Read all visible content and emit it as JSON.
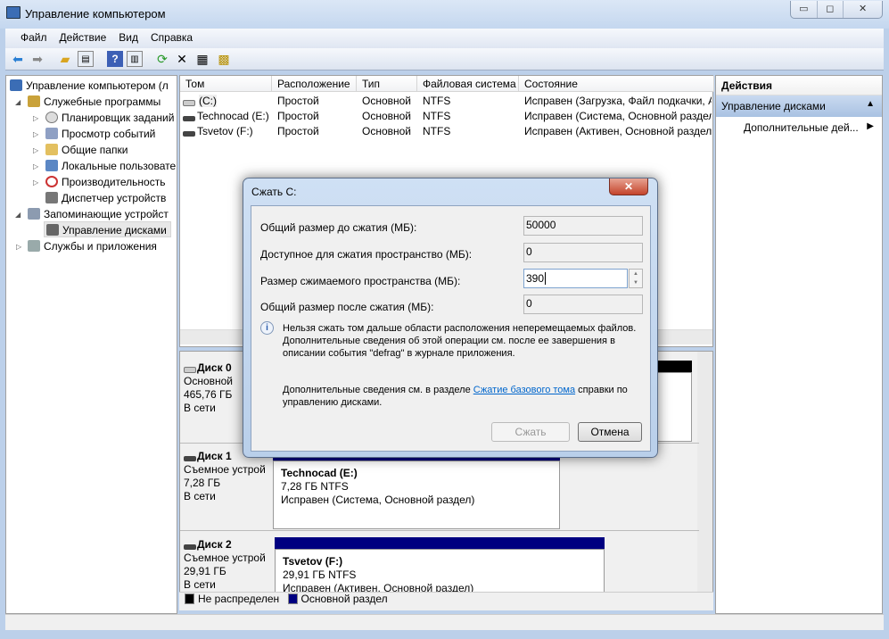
{
  "window": {
    "title": "Управление компьютером",
    "controls": {
      "minimize": "▭",
      "maximize": "◻",
      "close": "✕"
    }
  },
  "menu": [
    "Файл",
    "Действие",
    "Вид",
    "Справка"
  ],
  "toolbar": {
    "icons": [
      "back-icon",
      "forward-icon",
      "up-folder-icon",
      "show-hide-tree-icon",
      "help-icon",
      "show-action-pane-icon",
      "refresh-icon",
      "delete-icon",
      "properties-icon",
      "settings-icon"
    ]
  },
  "tree": {
    "root": "Управление компьютером (л",
    "items": [
      {
        "label": "Служебные программы",
        "level": 1,
        "expanded": true
      },
      {
        "label": "Планировщик заданий",
        "level": 2
      },
      {
        "label": "Просмотр событий",
        "level": 2
      },
      {
        "label": "Общие папки",
        "level": 2
      },
      {
        "label": "Локальные пользовате",
        "level": 2
      },
      {
        "label": "Производительность",
        "level": 2
      },
      {
        "label": "Диспетчер устройств",
        "level": 2
      },
      {
        "label": "Запоминающие устройст",
        "level": 1,
        "expanded": true
      },
      {
        "label": "Управление дисками",
        "level": 2,
        "selected": true
      },
      {
        "label": "Службы и приложения",
        "level": 1
      }
    ]
  },
  "volumes": {
    "columns": [
      "Том",
      "Расположение",
      "Тип",
      "Файловая система",
      "Состояние"
    ],
    "rows": [
      [
        "(C:)",
        "Простой",
        "Основной",
        "NTFS",
        "Исправен (Загрузка, Файл подкачки, А"
      ],
      [
        "Technocad (E:)",
        "Простой",
        "Основной",
        "NTFS",
        "Исправен (Система, Основной раздел"
      ],
      [
        "Tsvetov (F:)",
        "Простой",
        "Основной",
        "NTFS",
        "Исправен (Активен, Основной раздел)"
      ]
    ]
  },
  "disks": [
    {
      "name": "Диск 0",
      "type": "Основной",
      "size": "465,76 ГБ",
      "status": "В сети"
    },
    {
      "name": "Диск 1",
      "type": "Съемное устрой",
      "size": "7,28 ГБ",
      "status": "В сети",
      "partition": {
        "name": "Technocad  (E:)",
        "size": "7,28 ГБ NTFS",
        "status": "Исправен (Система, Основной раздел)"
      }
    },
    {
      "name": "Диск 2",
      "type": "Съемное устрой",
      "size": "29,91 ГБ",
      "status": "В сети",
      "partition": {
        "name": "Tsvetov  (F:)",
        "size": "29,91 ГБ NTFS",
        "status": "Исправен (Активен, Основной раздел)"
      }
    }
  ],
  "legend": [
    {
      "label": "Не распределен",
      "color": "#000000"
    },
    {
      "label": "Основной раздел",
      "color": "#000080"
    }
  ],
  "actions": {
    "title": "Действия",
    "section": "Управление дисками",
    "item": "Дополнительные дей..."
  },
  "dialog": {
    "title": "Сжать C:",
    "fields": [
      {
        "label": "Общий размер до сжатия (МБ):",
        "value": "50000"
      },
      {
        "label": "Доступное для сжатия пространство (МБ):",
        "value": "0"
      },
      {
        "label": "Размер сжимаемого пространства (МБ):",
        "value": "390"
      },
      {
        "label": "Общий размер после сжатия (МБ):",
        "value": "0"
      }
    ],
    "info": "Нельзя сжать том дальше области расположения неперемещаемых файлов. Дополнительные сведения об этой операции см. после ее завершения в описании события \"defrag\" в журнале приложения.",
    "help_prefix": "Дополнительные сведения см. в разделе ",
    "help_link": "Сжатие базового тома",
    "help_suffix": " справки по управлению дисками.",
    "shrink_button": "Сжать",
    "cancel_button": "Отмена"
  }
}
